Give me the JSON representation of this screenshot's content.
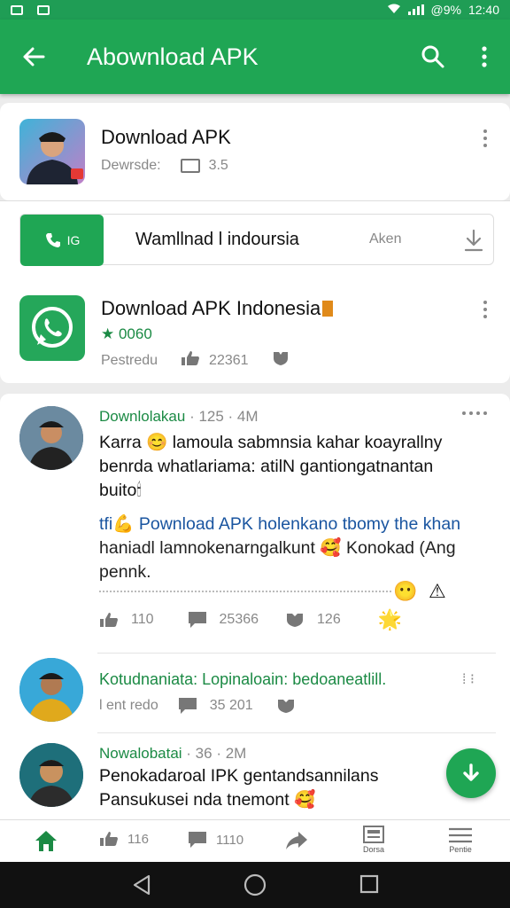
{
  "status_bar": {
    "battery": "@9%",
    "time": "12:40"
  },
  "app_bar": {
    "title": "Abownload APK"
  },
  "app_card": {
    "title": "Download APK",
    "meta_label": "Dewrsde:",
    "meta_value": "3.5"
  },
  "call_row": {
    "call_label": "IG",
    "name": "Wamllnad l indoursia",
    "right_label": "Aken"
  },
  "app_card2": {
    "title": "Download APK Indonesia",
    "rating": "★ 0060",
    "meta_label": "Pestredu",
    "meta_value": "22361"
  },
  "posts": [
    {
      "author": "Downlolakau",
      "time": "· 125 · 4M",
      "text_lines": [
        "Karra 😊 lamoula sabmnsia kahar koayrallny",
        "benrda whatlariama: atilN gantiongatnantan",
        "buito🕯"
      ],
      "text_blue_word": "atilN",
      "text2_lines": [
        "tfi💪 Pownload APK holenkano tbomy the khan",
        "haniadl lamnokenarngalkunt 🥰 Konokad (Ang",
        "pennk."
      ],
      "likes": "110",
      "comments": "25366",
      "shares": "126"
    },
    {
      "author": "Kotudnaniata:",
      "author_rest": "Lopinaloain: bedoaneatlill.",
      "meta_label": "l ent redo",
      "comments": "35 201"
    },
    {
      "author": "Nowalobatai",
      "time": "· 36 · 2M",
      "text_lines": [
        "Penokadaroal IPK gentandsannilans",
        "Pansukusei nda tnemont 🥰"
      ]
    }
  ],
  "bottom_bar": {
    "likes": "116",
    "comments": "1110",
    "tab4_label": "Dorsa",
    "tab5_label": "Pentie"
  },
  "colors": {
    "accent": "#1fa654",
    "link_green": "#1b8a44",
    "link_blue": "#1a55a0"
  }
}
